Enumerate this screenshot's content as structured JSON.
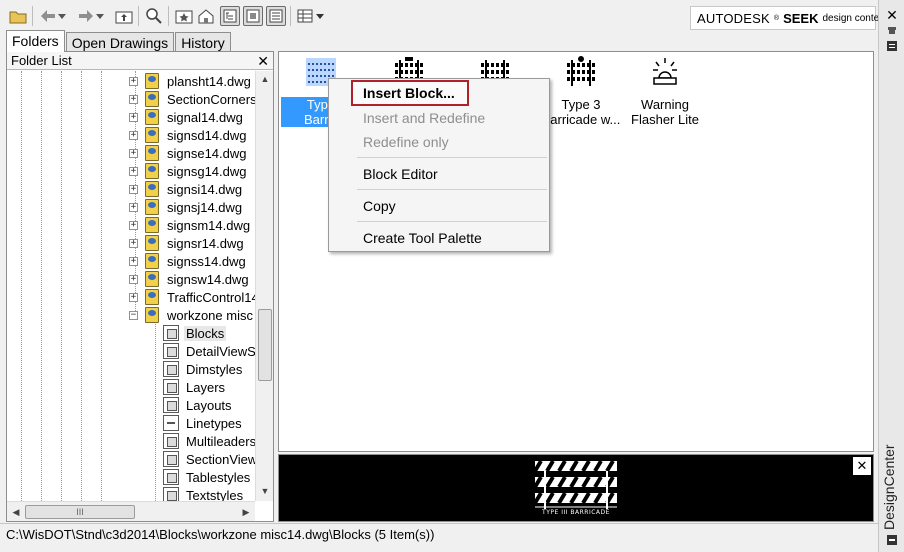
{
  "toolbar": {
    "banner_brand": "AUTODESK",
    "banner_seek": "SEEK",
    "banner_sub": "design content",
    "icons": [
      "load-icon",
      "back-icon",
      "back-dropdown-icon",
      "forward-icon",
      "forward-dropdown-icon",
      "up-icon",
      "search-icon",
      "favorites-icon",
      "home-icon",
      "tree-toggle-icon",
      "preview-toggle-icon",
      "description-toggle-icon",
      "views-icon",
      "views-dropdown-icon"
    ]
  },
  "tabs": [
    "Folders",
    "Open Drawings",
    "History"
  ],
  "folder_list": {
    "header": "Folder List",
    "close": "✕",
    "items": [
      {
        "label": "plansht14.dwg",
        "type": "dwg"
      },
      {
        "label": "SectionCorners",
        "type": "dwg"
      },
      {
        "label": "signal14.dwg",
        "type": "dwg"
      },
      {
        "label": "signsd14.dwg",
        "type": "dwg"
      },
      {
        "label": "signse14.dwg",
        "type": "dwg"
      },
      {
        "label": "signsg14.dwg",
        "type": "dwg"
      },
      {
        "label": "signsi14.dwg",
        "type": "dwg"
      },
      {
        "label": "signsj14.dwg",
        "type": "dwg"
      },
      {
        "label": "signsm14.dwg",
        "type": "dwg"
      },
      {
        "label": "signsr14.dwg",
        "type": "dwg"
      },
      {
        "label": "signss14.dwg",
        "type": "dwg"
      },
      {
        "label": "signsw14.dwg",
        "type": "dwg"
      },
      {
        "label": "TrafficControl14",
        "type": "dwg"
      },
      {
        "label": "workzone misc",
        "type": "dwg",
        "expanded": true
      }
    ],
    "children": [
      {
        "label": "Blocks",
        "selected": true
      },
      {
        "label": "DetailViewS"
      },
      {
        "label": "Dimstyles"
      },
      {
        "label": "Layers"
      },
      {
        "label": "Layouts"
      },
      {
        "label": "Linetypes"
      },
      {
        "label": "Multileaders"
      },
      {
        "label": "SectionView"
      },
      {
        "label": "Tablestyles"
      },
      {
        "label": "Textstyles"
      }
    ]
  },
  "blocks": [
    {
      "line1": "Type",
      "line2": "Barric",
      "selected": true
    },
    {
      "line1": "",
      "line2": ""
    },
    {
      "line1": "",
      "line2": ""
    },
    {
      "line1": "Type 3",
      "line2": "Barricade w..."
    },
    {
      "line1": "Warning",
      "line2": "Flasher Lite"
    }
  ],
  "context_menu": {
    "items": [
      {
        "label": "Insert Block...",
        "enabled": true,
        "highlighted": true
      },
      {
        "label": "Insert and Redefine",
        "enabled": false
      },
      {
        "label": "Redefine only",
        "enabled": false
      },
      {
        "label": "Block Editor",
        "enabled": true
      },
      {
        "label": "Copy",
        "enabled": true
      },
      {
        "label": "Create Tool Palette",
        "enabled": true
      }
    ]
  },
  "preview": {
    "caption": "TYPE III BARRICADE",
    "close": "✕"
  },
  "status_bar": "C:\\WisDOT\\Stnd\\c3d2014\\Blocks\\workzone misc14.dwg\\Blocks (5 Item(s))",
  "palette_title": "DesignCenter",
  "colors": {
    "selection": "#3399ff",
    "highlight_border": "#b0202a",
    "preview_bg": "#000000"
  }
}
